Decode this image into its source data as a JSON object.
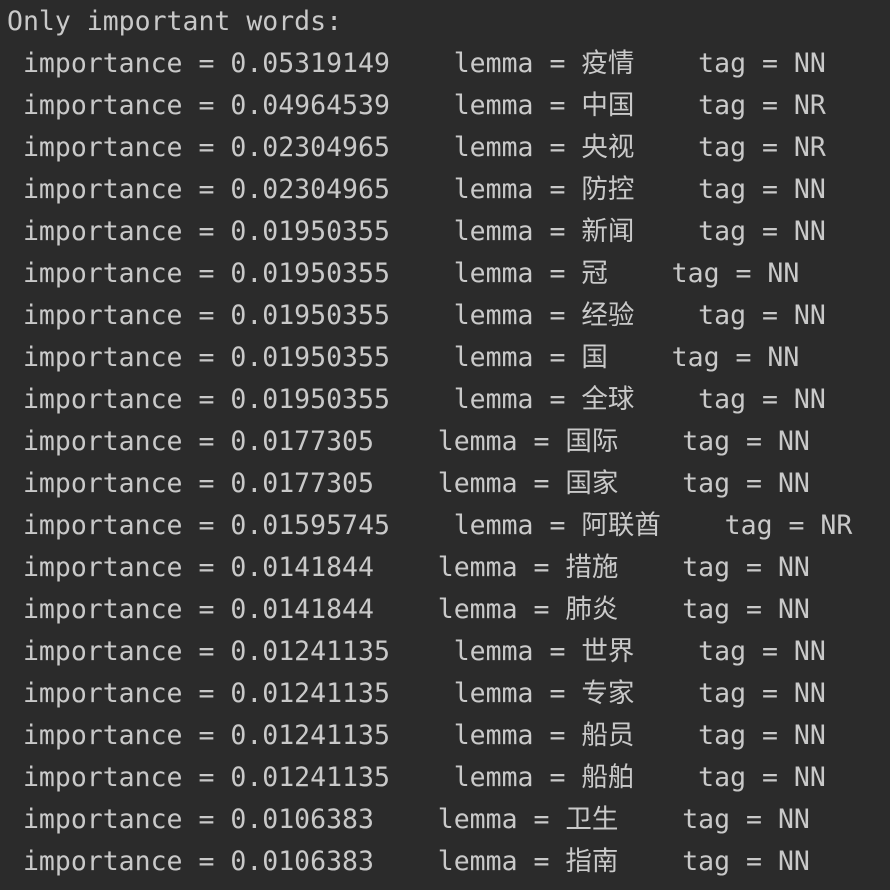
{
  "console": {
    "header": "Only important words:",
    "lines": [
      " importance = 0.05319149    lemma = 疫情    tag = NN",
      " importance = 0.04964539    lemma = 中国    tag = NR",
      " importance = 0.02304965    lemma = 央视    tag = NR",
      " importance = 0.02304965    lemma = 防控    tag = NN",
      " importance = 0.01950355    lemma = 新闻    tag = NN",
      " importance = 0.01950355    lemma = 冠    tag = NN",
      " importance = 0.01950355    lemma = 经验    tag = NN",
      " importance = 0.01950355    lemma = 国    tag = NN",
      " importance = 0.01950355    lemma = 全球    tag = NN",
      " importance = 0.0177305    lemma = 国际    tag = NN",
      " importance = 0.0177305    lemma = 国家    tag = NN",
      " importance = 0.01595745    lemma = 阿联酋    tag = NR",
      " importance = 0.0141844    lemma = 措施    tag = NN",
      " importance = 0.0141844    lemma = 肺炎    tag = NN",
      " importance = 0.01241135    lemma = 世界    tag = NN",
      " importance = 0.01241135    lemma = 专家    tag = NN",
      " importance = 0.01241135    lemma = 船员    tag = NN",
      " importance = 0.01241135    lemma = 船舶    tag = NN",
      " importance = 0.0106383    lemma = 卫生    tag = NN",
      " importance = 0.0106383    lemma = 指南    tag = NN"
    ]
  }
}
